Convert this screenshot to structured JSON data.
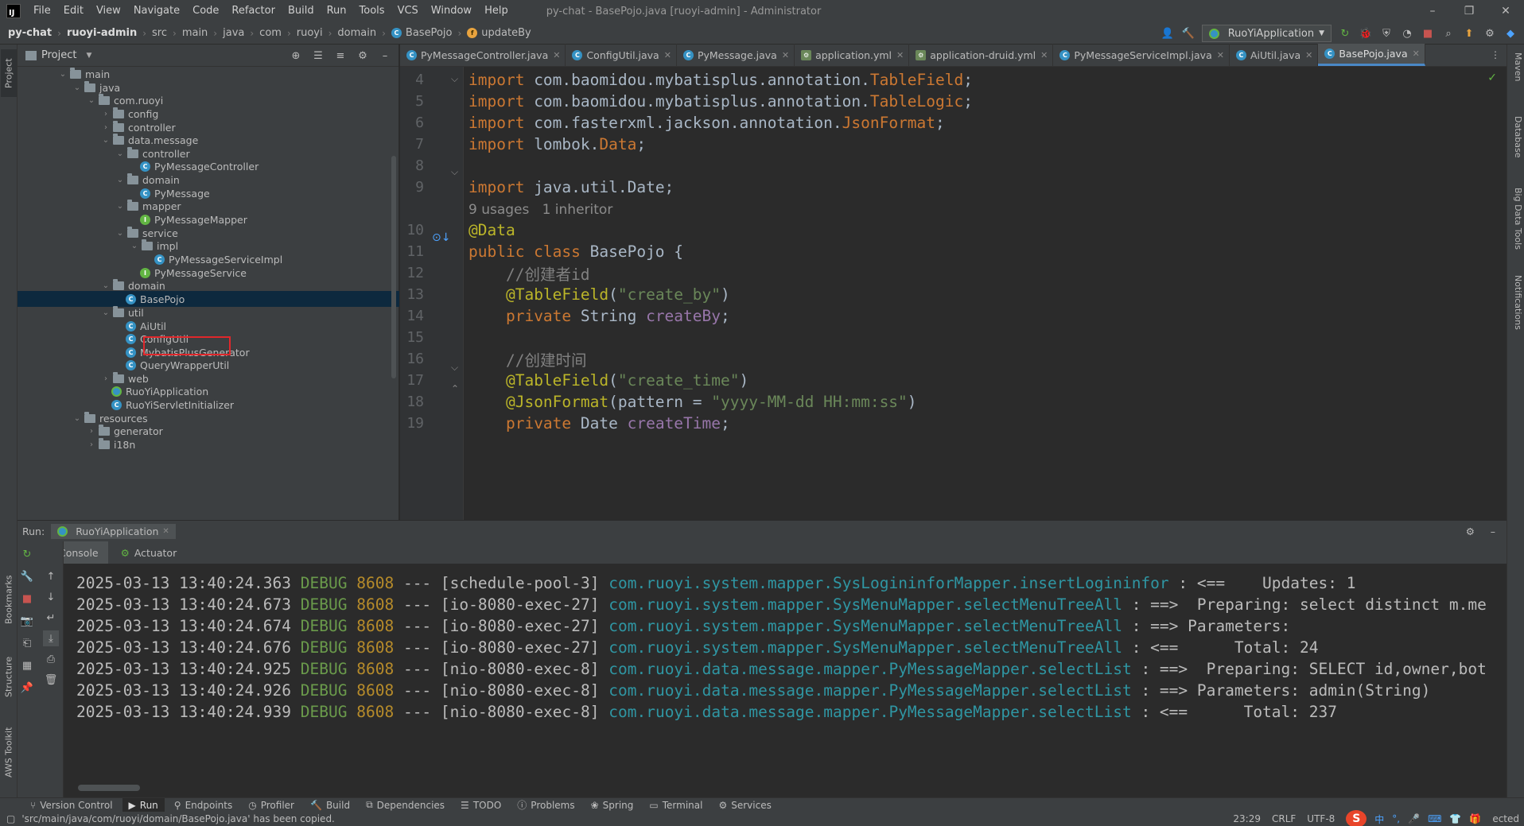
{
  "menubar": {
    "items": [
      "File",
      "Edit",
      "View",
      "Navigate",
      "Code",
      "Refactor",
      "Build",
      "Run",
      "Tools",
      "VCS",
      "Window",
      "Help"
    ],
    "title": "py-chat - BasePojo.java [ruoyi-admin] - Administrator",
    "logo": "IJ",
    "controls": [
      "–",
      "❐",
      "✕"
    ]
  },
  "navbar": {
    "crumbs": [
      "py-chat",
      "ruoyi-admin",
      "src",
      "main",
      "java",
      "com",
      "ruoyi",
      "domain",
      "BasePojo",
      "updateBy"
    ],
    "run_config": "RuoYiApplication"
  },
  "left_strip": {
    "project": "Project",
    "bookmarks": "Bookmarks",
    "structure": "Structure",
    "aws": "AWS Toolkit"
  },
  "right_strip": {
    "maven": "Maven",
    "database": "Database",
    "bigdata": "Big Data Tools",
    "notifications": "Notifications"
  },
  "project": {
    "title": "Project",
    "tree": [
      {
        "label": "main",
        "kind": "folder",
        "depth": 3,
        "open": true
      },
      {
        "label": "java",
        "kind": "folder",
        "depth": 4,
        "open": true
      },
      {
        "label": "com.ruoyi",
        "kind": "folder",
        "depth": 5,
        "open": true
      },
      {
        "label": "config",
        "kind": "folder",
        "depth": 6,
        "open": false
      },
      {
        "label": "controller",
        "kind": "folder",
        "depth": 6,
        "open": false
      },
      {
        "label": "data.message",
        "kind": "folder",
        "depth": 6,
        "open": true
      },
      {
        "label": "controller",
        "kind": "folder",
        "depth": 7,
        "open": true
      },
      {
        "label": "PyMessageController",
        "kind": "class",
        "depth": 8
      },
      {
        "label": "domain",
        "kind": "folder",
        "depth": 7,
        "open": true
      },
      {
        "label": "PyMessage",
        "kind": "class",
        "depth": 8
      },
      {
        "label": "mapper",
        "kind": "folder",
        "depth": 7,
        "open": true
      },
      {
        "label": "PyMessageMapper",
        "kind": "interface",
        "depth": 8
      },
      {
        "label": "service",
        "kind": "folder",
        "depth": 7,
        "open": true
      },
      {
        "label": "impl",
        "kind": "folder",
        "depth": 8,
        "open": true
      },
      {
        "label": "PyMessageServiceImpl",
        "kind": "class",
        "depth": 9
      },
      {
        "label": "PyMessageService",
        "kind": "interface",
        "depth": 8
      },
      {
        "label": "domain",
        "kind": "folder",
        "depth": 6,
        "open": true
      },
      {
        "label": "BasePojo",
        "kind": "class",
        "depth": 7,
        "selected": true
      },
      {
        "label": "util",
        "kind": "folder",
        "depth": 6,
        "open": true
      },
      {
        "label": "AiUtil",
        "kind": "class",
        "depth": 7
      },
      {
        "label": "ConfigUtil",
        "kind": "class",
        "depth": 7
      },
      {
        "label": "MybatisPlusGenerator",
        "kind": "class",
        "depth": 7
      },
      {
        "label": "QueryWrapperUtil",
        "kind": "class",
        "depth": 7
      },
      {
        "label": "web",
        "kind": "folder",
        "depth": 6,
        "open": false
      },
      {
        "label": "RuoYiApplication",
        "kind": "app",
        "depth": 6
      },
      {
        "label": "RuoYiServletInitializer",
        "kind": "class",
        "depth": 6
      },
      {
        "label": "resources",
        "kind": "folder",
        "depth": 4,
        "open": true
      },
      {
        "label": "generator",
        "kind": "folder",
        "depth": 5,
        "open": false
      },
      {
        "label": "i18n",
        "kind": "folder",
        "depth": 5,
        "open": false
      }
    ]
  },
  "editor": {
    "tabs": [
      {
        "label": "PyMessageController.java",
        "icon": "class"
      },
      {
        "label": "ConfigUtil.java",
        "icon": "class"
      },
      {
        "label": "PyMessage.java",
        "icon": "class"
      },
      {
        "label": "application.yml",
        "icon": "yml"
      },
      {
        "label": "application-druid.yml",
        "icon": "yml"
      },
      {
        "label": "PyMessageServiceImpl.java",
        "icon": "class"
      },
      {
        "label": "AiUtil.java",
        "icon": "class"
      },
      {
        "label": "BasePojo.java",
        "icon": "class",
        "active": true
      }
    ],
    "lines": [
      {
        "ln": "4",
        "html": "<span class=\"kw\">import</span> com.baomidou.mybatisplus.annotation.<span class=\"kw\">TableField</span>;"
      },
      {
        "ln": "5",
        "html": "<span class=\"kw\">import</span> com.baomidou.mybatisplus.annotation.<span class=\"kw\">TableLogic</span>;"
      },
      {
        "ln": "6",
        "html": "<span class=\"kw\">import</span> com.fasterxml.jackson.annotation.<span class=\"kw\">JsonFormat</span>;"
      },
      {
        "ln": "7",
        "html": "<span class=\"kw\">import</span> lombok.<span class=\"kw\">Data</span>;"
      },
      {
        "ln": "8",
        "html": ""
      },
      {
        "ln": "9",
        "html": "<span class=\"kw\">import</span> java.util.Date;"
      },
      {
        "ln": "",
        "html": "<span class=\"hint\">9 usages   1 inheritor</span>"
      },
      {
        "ln": "10",
        "html": "<span class=\"ann\">@Data</span>"
      },
      {
        "ln": "11",
        "html": "<span class=\"kw\">public class</span> BasePojo {"
      },
      {
        "ln": "12",
        "html": "    <span class=\"cmt\">//创建者id</span>"
      },
      {
        "ln": "13",
        "html": "    <span class=\"ann\">@TableField</span>(<span class=\"str\">\"create_by\"</span>)"
      },
      {
        "ln": "14",
        "html": "    <span class=\"kw\">private</span> String <span class=\"fld\">createBy</span>;"
      },
      {
        "ln": "15",
        "html": ""
      },
      {
        "ln": "16",
        "html": "    <span class=\"cmt\">//创建时间</span>"
      },
      {
        "ln": "17",
        "html": "    <span class=\"ann\">@TableField</span>(<span class=\"str\">\"create_time\"</span>)"
      },
      {
        "ln": "18",
        "html": "    <span class=\"ann\">@JsonFormat</span>(pattern = <span class=\"str\">\"yyyy-MM-dd HH:mm:ss\"</span>)"
      },
      {
        "ln": "19",
        "html": "    <span class=\"kw\">private</span> Date <span class=\"fld\">createTime</span>;"
      }
    ]
  },
  "run": {
    "label": "Run:",
    "config": "RuoYiApplication",
    "subtabs": [
      "Console",
      "Actuator"
    ],
    "log": [
      {
        "ts": "2025-03-13 13:40:24.363",
        "level": "DEBUG",
        "pid": "8608",
        "thread": "--- [schedule-pool-3]",
        "logger": "com.ruoyi.system.mapper.SysLogininforMapper.insertLogininfor",
        "msg": " : <==    Updates: 1"
      },
      {
        "ts": "2025-03-13 13:40:24.673",
        "level": "DEBUG",
        "pid": "8608",
        "thread": "--- [io-8080-exec-27]",
        "logger": "com.ruoyi.system.mapper.SysMenuMapper.selectMenuTreeAll",
        "msg": " : ==>  Preparing: select distinct m.me"
      },
      {
        "ts": "2025-03-13 13:40:24.674",
        "level": "DEBUG",
        "pid": "8608",
        "thread": "--- [io-8080-exec-27]",
        "logger": "com.ruoyi.system.mapper.SysMenuMapper.selectMenuTreeAll",
        "msg": " : ==> Parameters: "
      },
      {
        "ts": "2025-03-13 13:40:24.676",
        "level": "DEBUG",
        "pid": "8608",
        "thread": "--- [io-8080-exec-27]",
        "logger": "com.ruoyi.system.mapper.SysMenuMapper.selectMenuTreeAll",
        "msg": " : <==      Total: 24"
      },
      {
        "ts": "2025-03-13 13:40:24.925",
        "level": "DEBUG",
        "pid": "8608",
        "thread": "--- [nio-8080-exec-8]",
        "logger": "com.ruoyi.data.message.mapper.PyMessageMapper.selectList",
        "msg": " : ==>  Preparing: SELECT id,owner,bot"
      },
      {
        "ts": "2025-03-13 13:40:24.926",
        "level": "DEBUG",
        "pid": "8608",
        "thread": "--- [nio-8080-exec-8]",
        "logger": "com.ruoyi.data.message.mapper.PyMessageMapper.selectList",
        "msg": " : ==> Parameters: admin(String)"
      },
      {
        "ts": "2025-03-13 13:40:24.939",
        "level": "DEBUG",
        "pid": "8608",
        "thread": "--- [nio-8080-exec-8]",
        "logger": "com.ruoyi.data.message.mapper.PyMessageMapper.selectList",
        "msg": " : <==      Total: 237"
      }
    ]
  },
  "bottom_tabs": [
    {
      "label": "Version Control",
      "icon": "vcs-icon"
    },
    {
      "label": "Run",
      "icon": "run-icon",
      "active": true
    },
    {
      "label": "Endpoints",
      "icon": "endpoints-icon"
    },
    {
      "label": "Profiler",
      "icon": "profiler-icon"
    },
    {
      "label": "Build",
      "icon": "build-icon"
    },
    {
      "label": "Dependencies",
      "icon": "dependencies-icon"
    },
    {
      "label": "TODO",
      "icon": "todo-icon"
    },
    {
      "label": "Problems",
      "icon": "problems-icon"
    },
    {
      "label": "Spring",
      "icon": "spring-icon"
    },
    {
      "label": "Terminal",
      "icon": "terminal-icon"
    },
    {
      "label": "Services",
      "icon": "services-icon"
    }
  ],
  "status": {
    "message": "'src/main/java/com/ruoyi/domain/BasePojo.java' has been copied.",
    "position": "23:29",
    "line_ending": "CRLF",
    "encoding": "UTF-8",
    "tail": "ected",
    "ime": [
      "中",
      "°,",
      "🎤",
      "⌨",
      "👕",
      "🎁"
    ]
  },
  "colors": {
    "accent": "#4a88c7",
    "selection": "#0d293e",
    "highlight_box": "#e0272b",
    "run_green": "#62b543"
  }
}
